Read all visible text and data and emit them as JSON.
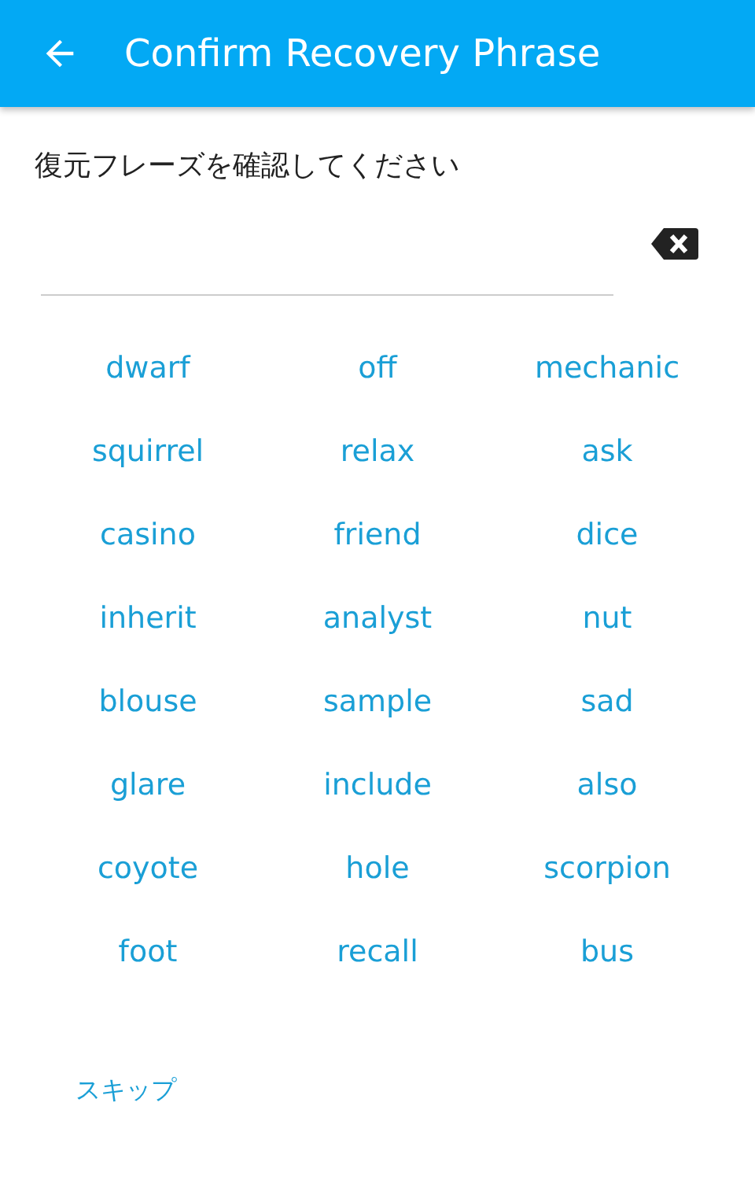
{
  "app_bar": {
    "title": "Confirm Recovery Phrase"
  },
  "prompt": "復元フレーズを確認してください",
  "words": [
    "dwarf",
    "off",
    "mechanic",
    "squirrel",
    "relax",
    "ask",
    "casino",
    "friend",
    "dice",
    "inherit",
    "analyst",
    "nut",
    "blouse",
    "sample",
    "sad",
    "glare",
    "include",
    "also",
    "coyote",
    "hole",
    "scorpion",
    "foot",
    "recall",
    "bus"
  ],
  "skip_button": "スキップ"
}
